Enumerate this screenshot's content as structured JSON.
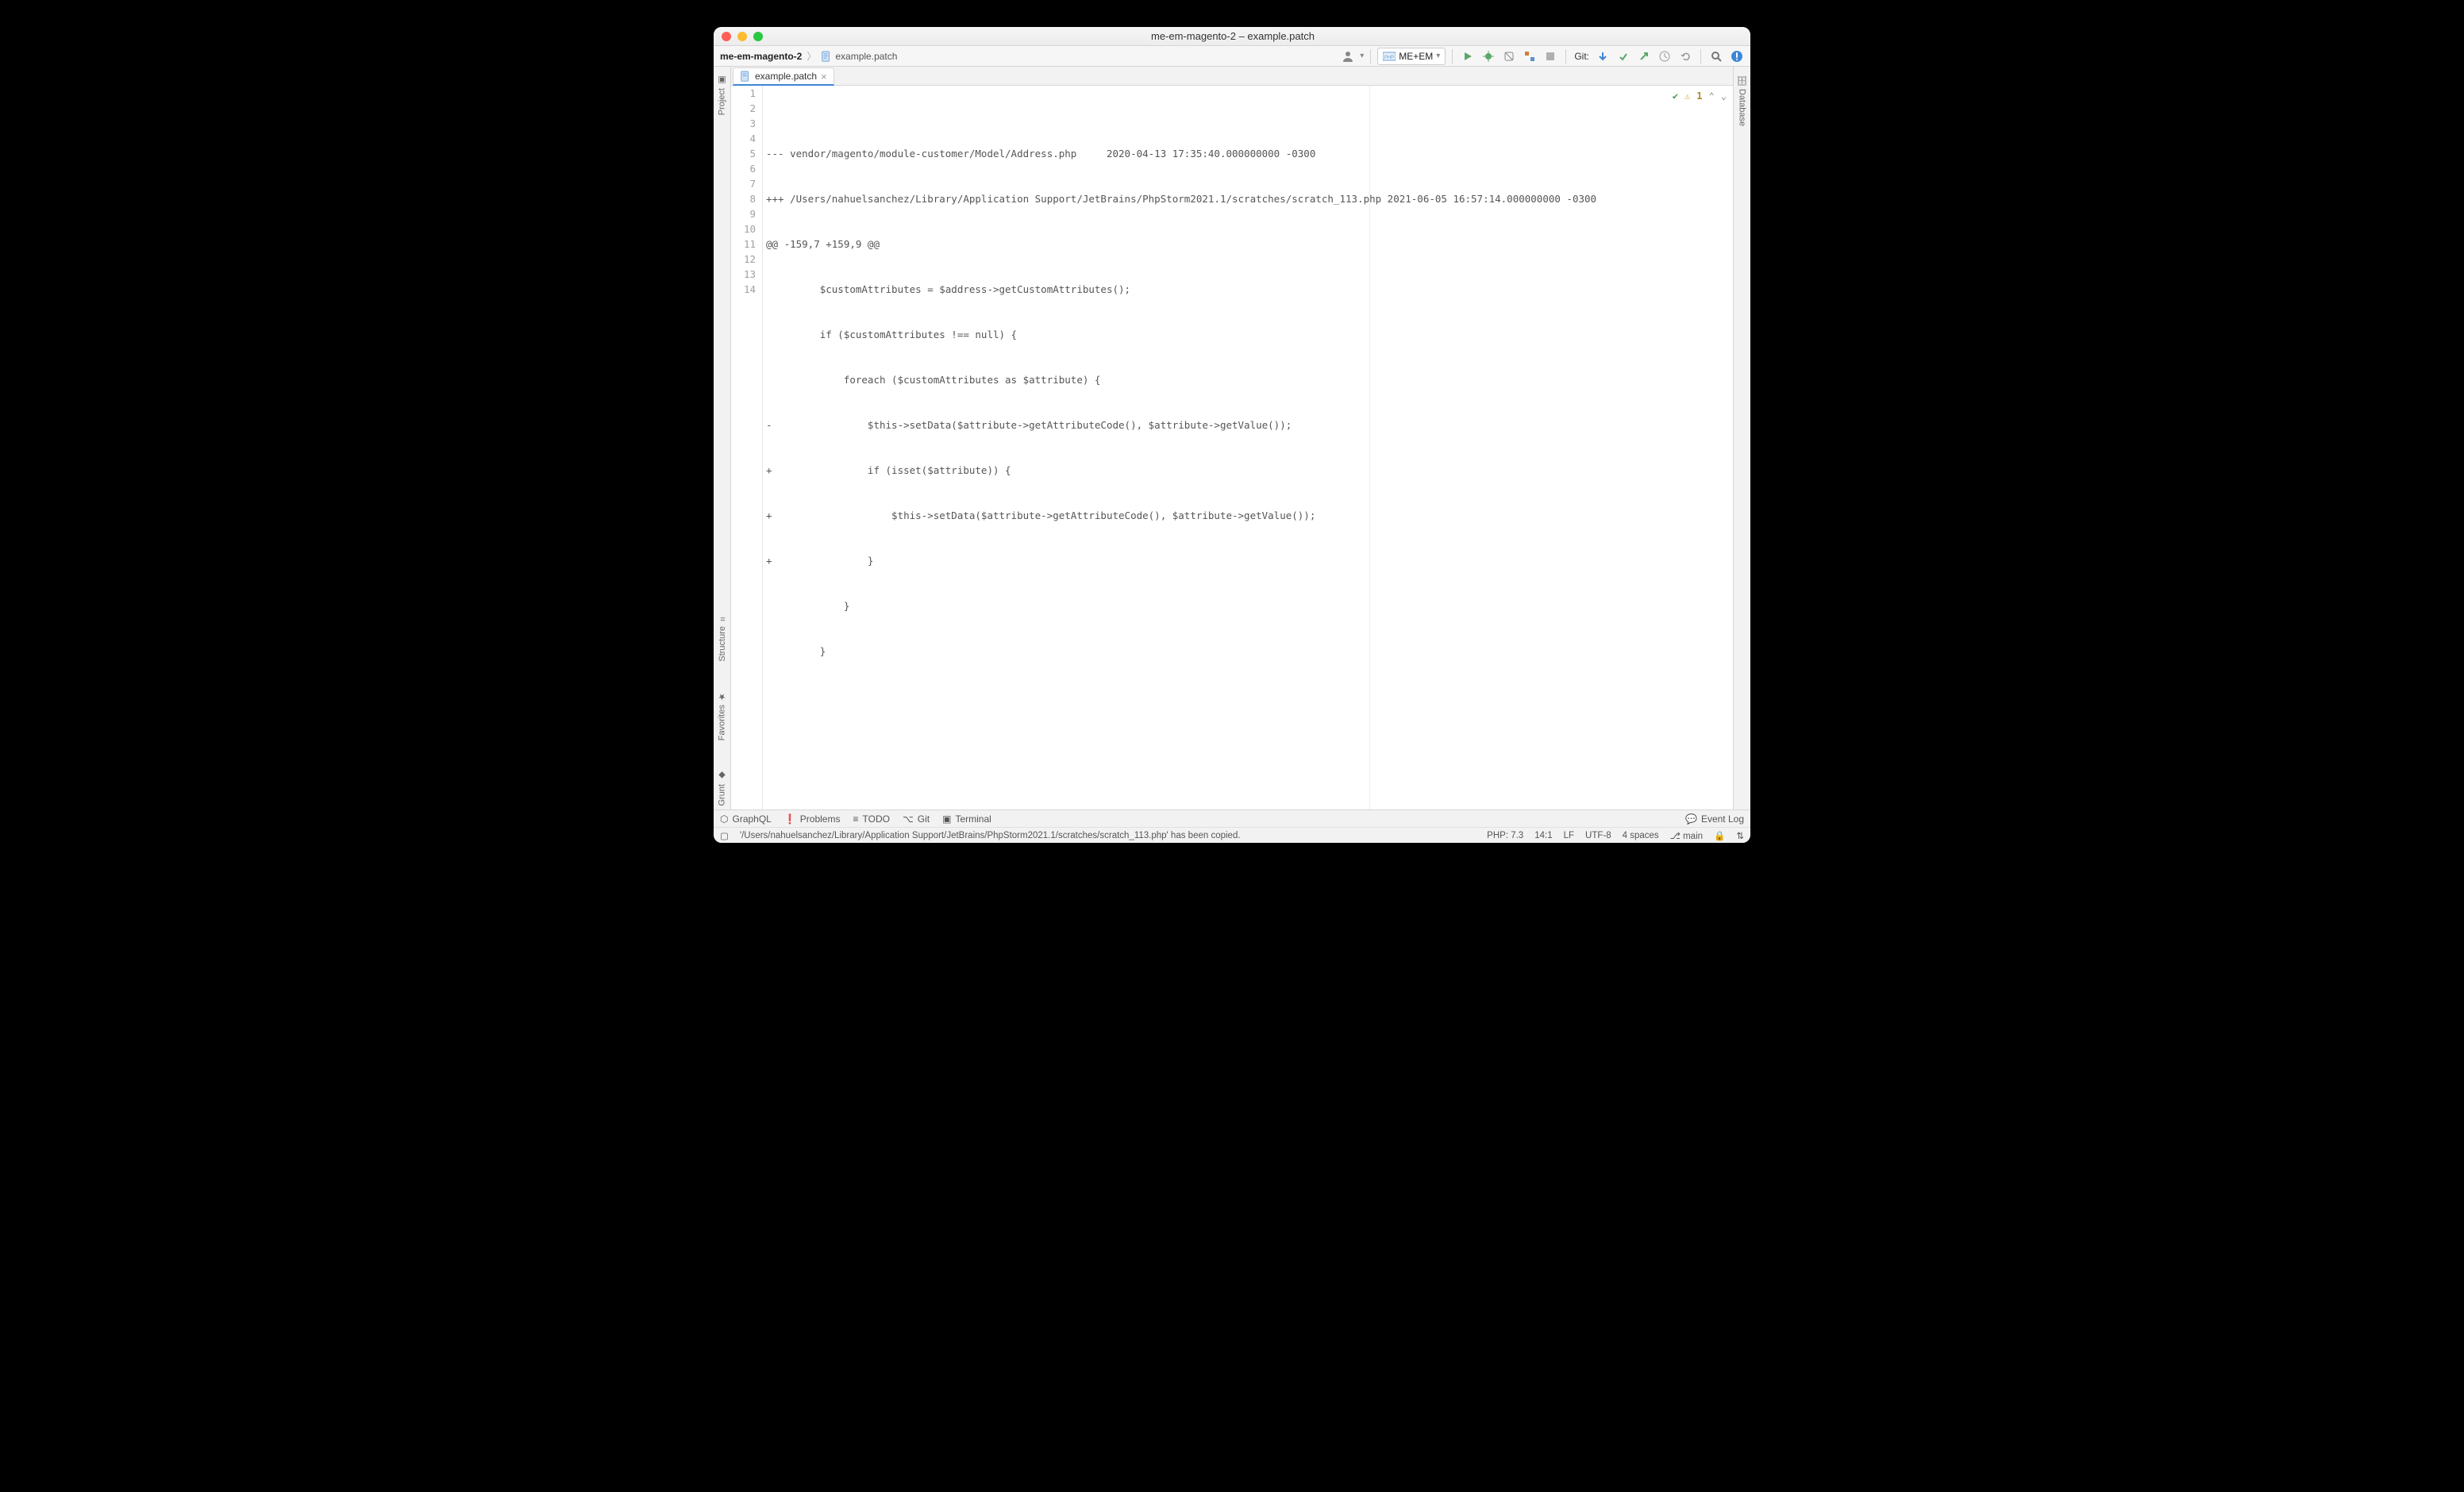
{
  "window": {
    "title": "me-em-magento-2 – example.patch"
  },
  "breadcrumb": {
    "project": "me-em-magento-2",
    "file": "example.patch"
  },
  "runconfig": {
    "label": "ME+EM",
    "prefix": "PHP"
  },
  "toolbar": {
    "git_label": "Git:"
  },
  "tab": {
    "label": "example.patch"
  },
  "inspection": {
    "warnings": "1"
  },
  "code": {
    "lines": [
      "--- vendor/magento/module-customer/Model/Address.php     2020-04-13 17:35:40.000000000 -0300",
      "+++ /Users/nahuelsanchez/Library/Application Support/JetBrains/PhpStorm2021.1/scratches/scratch_113.php 2021-06-05 16:57:14.000000000 -0300",
      "@@ -159,7 +159,9 @@",
      "         $customAttributes = $address->getCustomAttributes();",
      "         if ($customAttributes !== null) {",
      "             foreach ($customAttributes as $attribute) {",
      "-                $this->setData($attribute->getAttributeCode(), $attribute->getValue());",
      "+                if (isset($attribute)) {",
      "+                    $this->setData($attribute->getAttributeCode(), $attribute->getValue());",
      "+                }",
      "             }",
      "         }",
      "",
      ""
    ],
    "numbers": [
      "1",
      "2",
      "3",
      "4",
      "5",
      "6",
      "7",
      "8",
      "9",
      "10",
      "11",
      "12",
      "13",
      "14"
    ]
  },
  "leftrail": {
    "project": "Project",
    "structure": "Structure",
    "favorites": "Favorites",
    "grunt": "Grunt"
  },
  "rightrail": {
    "database": "Database"
  },
  "bottombar": {
    "graphql": "GraphQL",
    "problems": "Problems",
    "todo": "TODO",
    "git": "Git",
    "terminal": "Terminal",
    "eventlog": "Event Log"
  },
  "status": {
    "message": "'/Users/nahuelsanchez/Library/Application Support/JetBrains/PhpStorm2021.1/scratches/scratch_113.php' has been copied.",
    "php": "PHP: 7.3",
    "caret": "14:1",
    "eol": "LF",
    "encoding": "UTF-8",
    "indent": "4 spaces",
    "branch": "main"
  }
}
